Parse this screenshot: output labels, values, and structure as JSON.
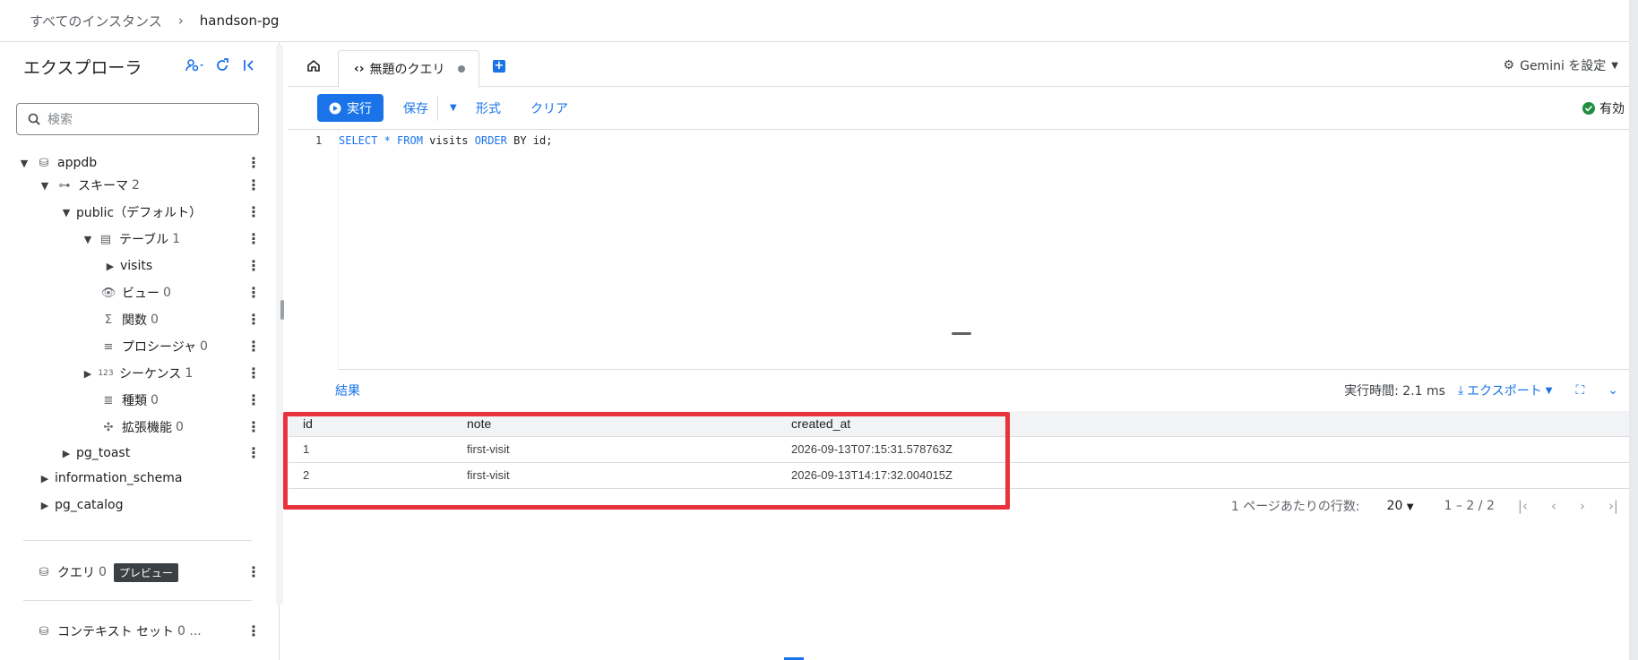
{
  "breadcrumb": {
    "parent": "すべてのインスタンス",
    "current": "handson-pg"
  },
  "explorer": {
    "title": "エクスプローラ",
    "search_placeholder": "検索",
    "tree": [
      {
        "label": "appdb",
        "count": ""
      },
      {
        "label": "スキーマ",
        "count": "2"
      },
      {
        "label": "public（デフォルト）",
        "count": ""
      },
      {
        "label": "テーブル",
        "count": "1"
      },
      {
        "label": "visits",
        "count": ""
      },
      {
        "label": "ビュー",
        "count": "0"
      },
      {
        "label": "関数",
        "count": "0"
      },
      {
        "label": "プロシージャ",
        "count": "0"
      },
      {
        "label": "シーケンス",
        "count": "1"
      },
      {
        "label": "種類",
        "count": "0"
      },
      {
        "label": "拡張機能",
        "count": "0"
      },
      {
        "label": "pg_toast",
        "count": ""
      },
      {
        "label": "information_schema",
        "count": ""
      },
      {
        "label": "pg_catalog",
        "count": ""
      }
    ],
    "queries": {
      "label": "クエリ",
      "count": "0",
      "badge": "プレビュー"
    },
    "context": {
      "label": "コンテキスト セット",
      "count": "0 ..."
    }
  },
  "tabs": {
    "query_tab": "無題のクエリ",
    "gemini": "Gemini を設定"
  },
  "toolbar": {
    "run": "実行",
    "save": "保存",
    "format": "形式",
    "clear": "クリア",
    "status": "有効"
  },
  "editor": {
    "line_number": "1",
    "code": {
      "kw1": "SELECT",
      "star": " * ",
      "kw2": "FROM",
      "t1": " visits ",
      "kw3": "ORDER",
      "t2": " BY id;"
    }
  },
  "results": {
    "tab": "結果",
    "exec_time": "実行時間: 2.1 ms",
    "export": "エクスポート",
    "columns": [
      "id",
      "note",
      "created_at"
    ],
    "rows": [
      [
        "1",
        "first-visit",
        "2026-09-13T07:15:31.578763Z"
      ],
      [
        "2",
        "first-visit",
        "2026-09-13T14:17:32.004015Z"
      ]
    ],
    "rows_per_page_label": "1 ページあたりの行数:",
    "rows_per_page": "20",
    "range": "1 – 2 / 2"
  },
  "colors": {
    "accent": "#1a73e8",
    "highlight": "#e8323c",
    "ok": "#1e8e3e"
  }
}
